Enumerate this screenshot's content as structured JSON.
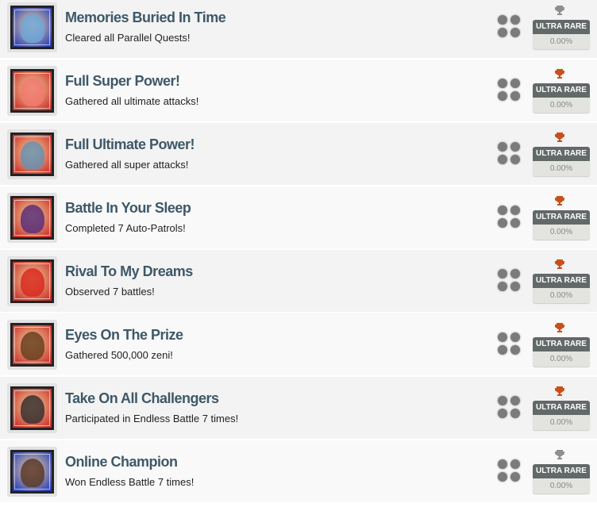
{
  "achievements": [
    {
      "title": "Memories Buried In Time",
      "description": "Cleared all Parallel Quests!",
      "rarity": "ULTRA RARE",
      "percent": "0.00%",
      "trophy_color": "#8f8f8f",
      "frame_color": "#2a3fb8",
      "art_color": "#6fa6d8",
      "icon": "character-portrait-icon"
    },
    {
      "title": "Full Super Power!",
      "description": "Gathered all ultimate attacks!",
      "rarity": "ULTRA RARE",
      "percent": "0.00%",
      "trophy_color": "#c8501a",
      "frame_color": "#c8302a",
      "art_color": "#f07a70",
      "icon": "character-portrait-icon"
    },
    {
      "title": "Full Ultimate Power!",
      "description": "Gathered all super attacks!",
      "rarity": "ULTRA RARE",
      "percent": "0.00%",
      "trophy_color": "#c8501a",
      "frame_color": "#c8302a",
      "art_color": "#6b8fb0",
      "icon": "character-portrait-icon"
    },
    {
      "title": "Battle In Your Sleep",
      "description": "Completed 7 Auto-Patrols!",
      "rarity": "ULTRA RARE",
      "percent": "0.00%",
      "trophy_color": "#c8501a",
      "frame_color": "#c8302a",
      "art_color": "#5a2f78",
      "icon": "purple-orb-icon"
    },
    {
      "title": "Rival To My Dreams",
      "description": "Observed 7 battles!",
      "rarity": "ULTRA RARE",
      "percent": "0.00%",
      "trophy_color": "#c8501a",
      "frame_color": "#c8302a",
      "art_color": "#d82a20",
      "icon": "kanji-emblem-icon"
    },
    {
      "title": "Eyes On The Prize",
      "description": "Gathered 500,000 zeni!",
      "rarity": "ULTRA RARE",
      "percent": "0.00%",
      "trophy_color": "#c8501a",
      "frame_color": "#c8302a",
      "art_color": "#6a4020",
      "icon": "character-portrait-icon"
    },
    {
      "title": "Take On All Challengers",
      "description": "Participated in Endless Battle 7 times!",
      "rarity": "ULTRA RARE",
      "percent": "0.00%",
      "trophy_color": "#c8501a",
      "frame_color": "#c8302a",
      "art_color": "#3a3030",
      "icon": "character-portrait-icon"
    },
    {
      "title": "Online Champion",
      "description": "Won Endless Battle 7 times!",
      "rarity": "ULTRA RARE",
      "percent": "0.00%",
      "trophy_color": "#8f8f8f",
      "frame_color": "#2a3fb8",
      "art_color": "#5a3a2a",
      "icon": "character-portrait-icon"
    }
  ]
}
